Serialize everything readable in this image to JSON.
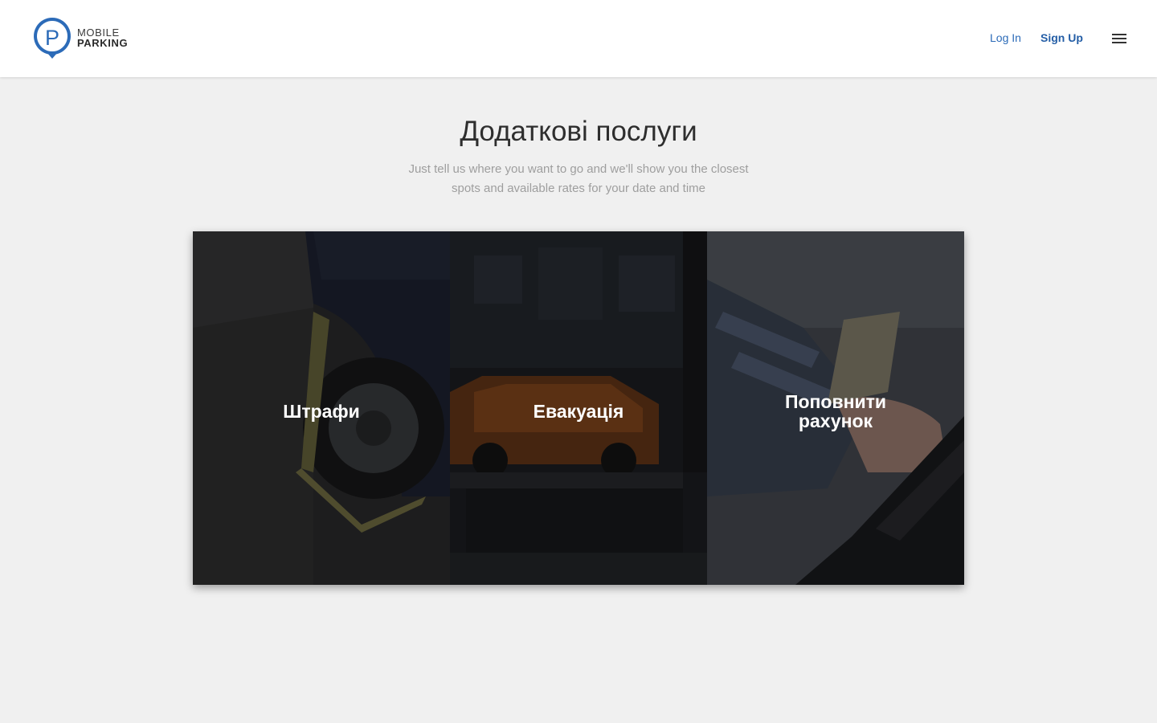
{
  "header": {
    "logo": {
      "letter": "P",
      "line1": "MOBILE",
      "line2": "PARKING"
    },
    "login_label": "Log In",
    "signup_label": "Sign Up",
    "menu_icon": "hamburger-menu-icon"
  },
  "main": {
    "title": "Додаткові послуги",
    "subtitle": "Just tell us where you want to go and we'll show you the closest spots and available rates for your date and time"
  },
  "services": [
    {
      "label": "Штрафи"
    },
    {
      "label": "Евакуація"
    },
    {
      "label": "Поповнити рахунок"
    }
  ],
  "colors": {
    "brand": "#2c6bb8",
    "background": "#f0f0f0",
    "header": "#ffffff"
  }
}
